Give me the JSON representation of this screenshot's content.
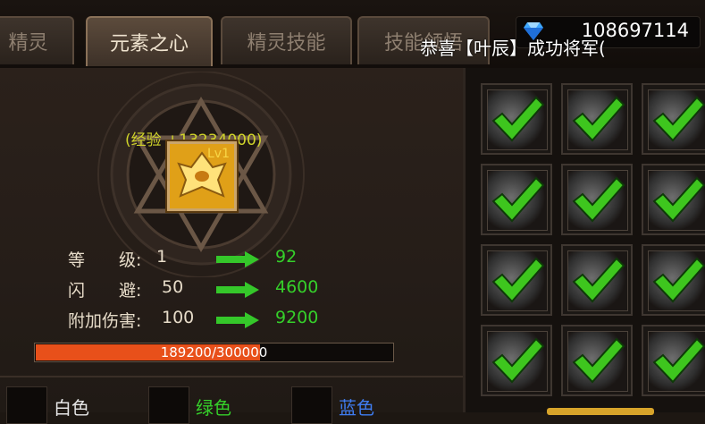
{
  "tabs": [
    {
      "label": "精灵"
    },
    {
      "label": "元素之心"
    },
    {
      "label": "精灵技能"
    },
    {
      "label": "技能领悟"
    }
  ],
  "currency": {
    "value": "108697114",
    "icon": "diamond-icon"
  },
  "notice": "恭喜【叶辰】成功将军(",
  "element": {
    "exp_gain": "(经验 +13234000)",
    "level_badge": "Lv1"
  },
  "stats": [
    {
      "label": "等　　级:",
      "current": "1",
      "next": "92"
    },
    {
      "label": "闪　　避:",
      "current": "50",
      "next": "4600"
    },
    {
      "label": "附加伤害:",
      "current": "100",
      "next": "9200"
    }
  ],
  "progress": {
    "text": "189200/300000",
    "fraction": 0.63067
  },
  "qualities": [
    {
      "label": "白色",
      "color": "#e6e6e6"
    },
    {
      "label": "绿色",
      "color": "#35d02a"
    },
    {
      "label": "蓝色",
      "color": "#3f7cf0"
    }
  ],
  "colors": {
    "accent_green": "#35d02a",
    "progress_fill": "#e8501a",
    "exp_text": "#cfd32a"
  }
}
